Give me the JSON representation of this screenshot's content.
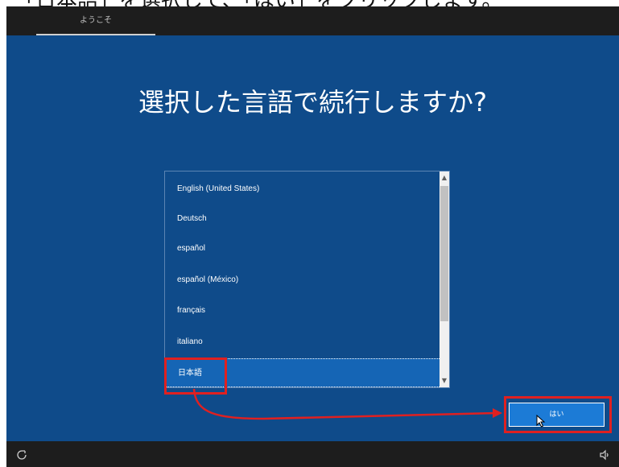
{
  "caption": {
    "text": "「日本語」を選択して、「はい」をクリックします。"
  },
  "header": {
    "tab_label": "ようこそ"
  },
  "main": {
    "heading": "選択した言語で続行しますか?",
    "languages": [
      {
        "label": "English (United States)"
      },
      {
        "label": "Deutsch"
      },
      {
        "label": "español"
      },
      {
        "label": "español (México)"
      },
      {
        "label": "français"
      },
      {
        "label": "italiano"
      },
      {
        "label": "日本語",
        "selected": true
      }
    ],
    "yes_button": "はい"
  },
  "footer": {
    "left_icon": "ease-of-access-icon",
    "right_icon": "volume-icon"
  },
  "colors": {
    "panel": "#0f4b8a",
    "selected": "#1565b5",
    "button": "#1c7bd6",
    "highlight": "#e02020"
  }
}
